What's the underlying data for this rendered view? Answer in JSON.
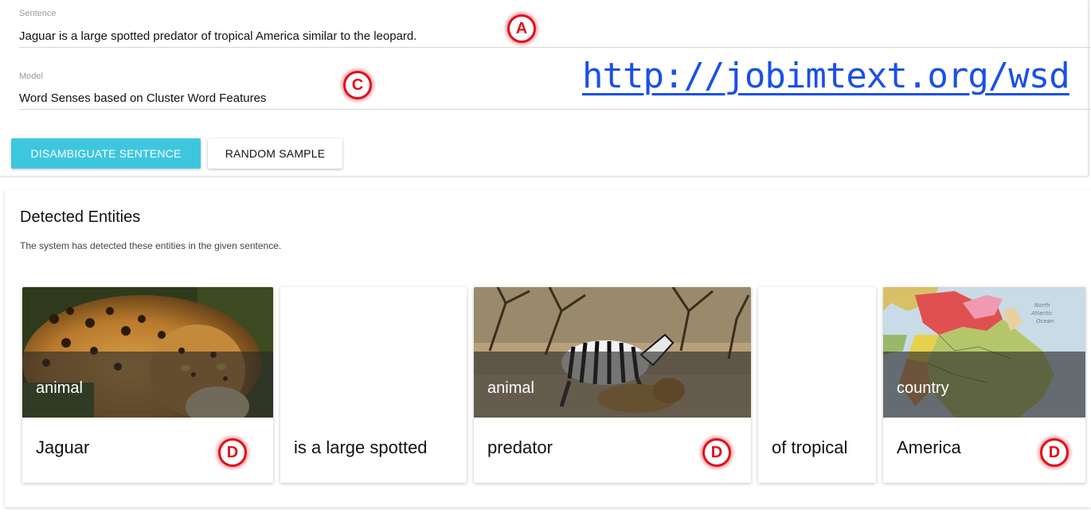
{
  "form": {
    "sentence_label": "Sentence",
    "sentence_value": "Jaguar is a large spotted predator of tropical America similar to the leopard.",
    "model_label": "Model",
    "model_value": "Word Senses based on Cluster Word Features",
    "disambiguate_label": "DISAMBIGUATE SENTENCE",
    "random_label": "RANDOM SAMPLE"
  },
  "url": "http://jobimtext.org/wsd",
  "markers": {
    "a": "A",
    "c": "C",
    "d": "D"
  },
  "results": {
    "title": "Detected Entities",
    "subtitle": "The system has detected these entities in the given sentence.",
    "cards": [
      {
        "word": "Jaguar",
        "category": "animal",
        "image": "jaguar-photo"
      },
      {
        "word": "is a large spotted"
      },
      {
        "word": "predator",
        "category": "animal",
        "image": "zebra-lion-photo"
      },
      {
        "word": "of tropical"
      },
      {
        "word": "America",
        "category": "country",
        "image": "south-america-map"
      }
    ]
  },
  "colors": {
    "primary_button": "#3ec6de",
    "link": "#1a50e8",
    "marker": "#e0101a"
  }
}
